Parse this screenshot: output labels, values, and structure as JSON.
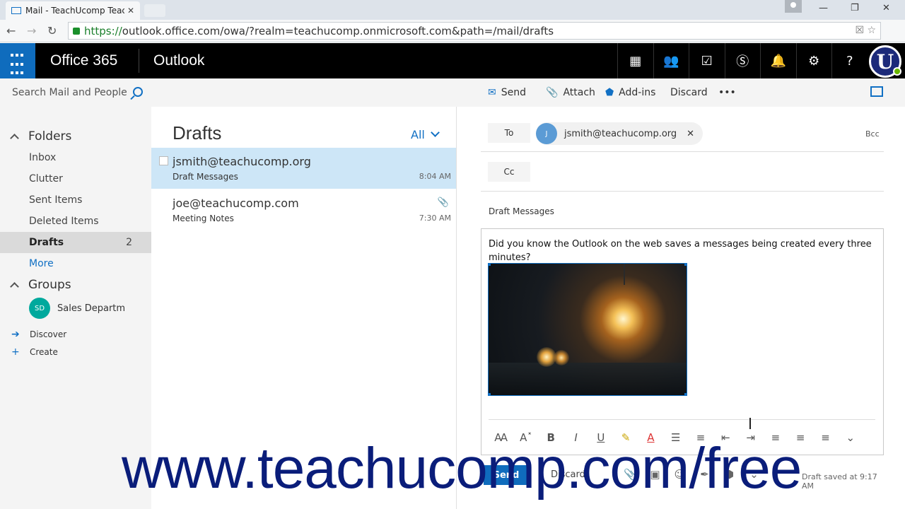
{
  "browser": {
    "tab_title": "Mail - TeachUcomp Teach",
    "url_secure": "https://",
    "url_rest": "outlook.office.com/owa/?realm=teachucomp.onmicrosoft.com&path=/mail/drafts",
    "icons": [
      "back-icon",
      "forward-icon",
      "reload-icon",
      "lock-icon",
      "star-icon",
      "menu-icon"
    ]
  },
  "header": {
    "brand": "Office 365",
    "app": "Outlook",
    "avatar_letter": "U",
    "icons": [
      "calendar-icon",
      "people-icon",
      "tasks-icon",
      "skype-icon",
      "bell-icon",
      "settings-icon",
      "help-icon"
    ]
  },
  "leftnav": {
    "search_placeholder": "Search Mail and People",
    "folders_label": "Folders",
    "items": [
      {
        "label": "Inbox"
      },
      {
        "label": "Clutter"
      },
      {
        "label": "Sent Items"
      },
      {
        "label": "Deleted Items"
      },
      {
        "label": "Drafts",
        "count": "2"
      },
      {
        "label": "More"
      }
    ],
    "groups_label": "Groups",
    "group": {
      "initials": "SD",
      "name": "Sales Departm"
    },
    "discover": "Discover",
    "create": "Create"
  },
  "cmdbar": {
    "send": "Send",
    "attach": "Attach",
    "addins": "Add-ins",
    "discard": "Discard",
    "more": "•••"
  },
  "msglist": {
    "title": "Drafts",
    "filter": "All",
    "messages": [
      {
        "from": "jsmith@teachucomp.org",
        "subject": "Draft Messages",
        "time": "8:04 AM"
      },
      {
        "from": "joe@teachucomp.com",
        "subject": "Meeting Notes",
        "time": "7:30 AM"
      }
    ]
  },
  "compose": {
    "to_label": "To",
    "cc_label": "Cc",
    "bcc_label": "Bcc",
    "recipient": {
      "initial": "J",
      "email": "jsmith@teachucomp.org"
    },
    "subject": "Draft Messages",
    "body": "Did you know the Outlook on the web saves a messages being created every three minutes?",
    "send": "Send",
    "discard": "Discard",
    "status": "Draft saved at 9:17 AM"
  },
  "watermark": "www.teachucomp.com/free",
  "colors": {
    "accent": "#0f6cbd",
    "selected": "#cde6f7",
    "watermark": "#0a1d7a"
  }
}
